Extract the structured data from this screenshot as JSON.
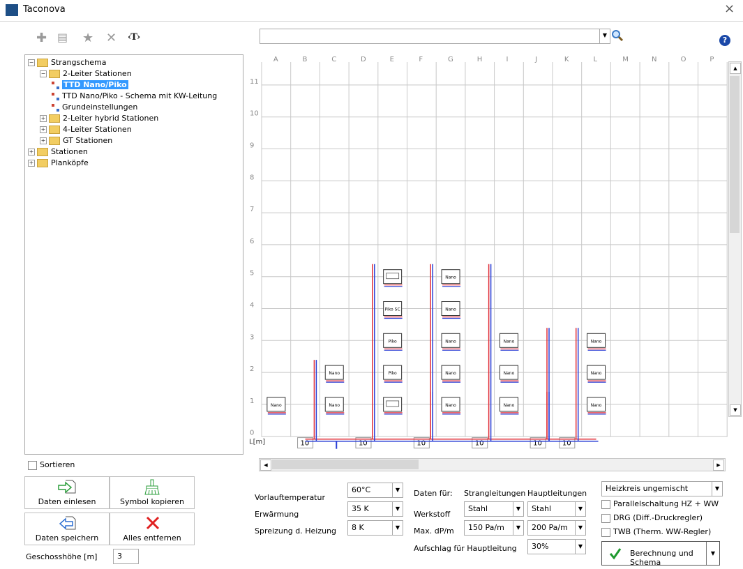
{
  "window": {
    "title": "Taconova",
    "close": "×"
  },
  "toolbar": {
    "add": "✚",
    "edit": "▤",
    "star": "★",
    "delete": "✕",
    "text": "‹T›",
    "help": "?"
  },
  "search": {
    "value": "",
    "icon": "search-icon"
  },
  "tree": [
    {
      "label": "Strangschema",
      "level": 0,
      "type": "folder",
      "expander": "−"
    },
    {
      "label": "2-Leiter Stationen",
      "level": 1,
      "type": "folder",
      "expander": "−"
    },
    {
      "label": "TTD Nano/Piko",
      "level": 2,
      "type": "leaf",
      "selected": true
    },
    {
      "label": "TTD Nano/Piko - Schema mit KW-Leitung",
      "level": 2,
      "type": "leaf"
    },
    {
      "label": "Grundeinstellungen",
      "level": 2,
      "type": "leaf"
    },
    {
      "label": "2-Leiter hybrid Stationen",
      "level": 1,
      "type": "folder",
      "expander": "+"
    },
    {
      "label": "4-Leiter Stationen",
      "level": 1,
      "type": "folder",
      "expander": "+"
    },
    {
      "label": "GT Stationen",
      "level": 1,
      "type": "folder",
      "expander": "+"
    },
    {
      "label": "Stationen",
      "level": 0,
      "type": "folder",
      "expander": "+"
    },
    {
      "label": "Planköpfe",
      "level": 0,
      "type": "folder",
      "expander": "+"
    }
  ],
  "sortieren": {
    "label": "Sortieren",
    "checked": false
  },
  "buttons": {
    "einlesen": "Daten einlesen",
    "kopieren": "Symbol kopieren",
    "speichern": "Daten speichern",
    "entfernen": "Alles entfernen"
  },
  "geschoss": {
    "label": "Geschosshöhe [m]",
    "value": "3"
  },
  "grid": {
    "cols": [
      "A",
      "B",
      "C",
      "D",
      "E",
      "F",
      "G",
      "H",
      "I",
      "J",
      "K",
      "L",
      "M",
      "N",
      "O",
      "P"
    ],
    "rows": [
      "11",
      "10",
      "9",
      "8",
      "7",
      "6",
      "5",
      "4",
      "3",
      "2",
      "1",
      "0"
    ],
    "lm_label": "L[m]",
    "lengths": [
      "",
      "10",
      "",
      "10",
      "",
      "10",
      "",
      "10",
      "",
      "10",
      "10",
      "",
      "",
      "",
      "",
      ""
    ],
    "dots": "...",
    "stations": [
      {
        "col": 5,
        "row": 5,
        "label": ""
      },
      {
        "col": 7,
        "row": 5,
        "label": "Nano"
      },
      {
        "col": 5,
        "row": 4,
        "label": "Piko SC"
      },
      {
        "col": 7,
        "row": 4,
        "label": "Nano"
      },
      {
        "col": 5,
        "row": 3,
        "label": "Piko"
      },
      {
        "col": 7,
        "row": 3,
        "label": "Nano"
      },
      {
        "col": 9,
        "row": 3,
        "label": "Nano"
      },
      {
        "col": 12,
        "row": 3,
        "label": "Nano"
      },
      {
        "col": 3,
        "row": 2,
        "label": "Nano"
      },
      {
        "col": 5,
        "row": 2,
        "label": "Piko"
      },
      {
        "col": 7,
        "row": 2,
        "label": "Nano"
      },
      {
        "col": 9,
        "row": 2,
        "label": "Nano"
      },
      {
        "col": 12,
        "row": 2,
        "label": "Nano"
      },
      {
        "col": 1,
        "row": 1,
        "label": "Nano"
      },
      {
        "col": 3,
        "row": 1,
        "label": "Nano"
      },
      {
        "col": 5,
        "row": 1,
        "label": ""
      },
      {
        "col": 7,
        "row": 1,
        "label": "Nano"
      },
      {
        "col": 9,
        "row": 1,
        "label": "Nano"
      },
      {
        "col": 12,
        "row": 1,
        "label": "Nano"
      }
    ],
    "risers": [
      {
        "col": 2,
        "from": 0,
        "to": 2
      },
      {
        "col": 4,
        "from": 0,
        "to": 5
      },
      {
        "col": 6,
        "from": 0,
        "to": 5
      },
      {
        "col": 6,
        "from": 0,
        "to": 1
      },
      {
        "col": 8,
        "from": 0,
        "to": 5
      },
      {
        "col": 10,
        "from": 0,
        "to": 3
      },
      {
        "col": 11,
        "from": 0,
        "to": 3
      },
      {
        "col": 10,
        "from": 0,
        "to": 1
      }
    ]
  },
  "form": {
    "vorlauf": {
      "label": "Vorlauftemperatur",
      "value": "60°C"
    },
    "erwaermung": {
      "label": "Erwärmung",
      "value": "35 K"
    },
    "spreizung": {
      "label": "Spreizung d. Heizung",
      "value": "8 K"
    },
    "daten_fuer": "Daten für:",
    "strang": "Strangleitungen",
    "haupt": "Hauptleitungen",
    "werkstoff": {
      "label": "Werkstoff",
      "strang": "Stahl",
      "haupt": "Stahl"
    },
    "maxdp": {
      "label": "Max. dP/m",
      "strang": "150 Pa/m",
      "haupt": "200 Pa/m"
    },
    "aufschlag": {
      "label": "Aufschlag für Hauptleitung",
      "value": "30%"
    }
  },
  "options": {
    "heizkreis": "Heizkreis ungemischt",
    "parallel": "Parallelschaltung HZ + WW",
    "drg": "DRG (Diff.-Druckregler)",
    "twb": "TWB (Therm. WW-Regler)"
  },
  "calc_button": "Berechnung und Schema",
  "colors": {
    "selection": "#3399ff",
    "pipe_red": "#e0303a",
    "pipe_blue": "#2b3fd6",
    "check": "#1f9a2f"
  }
}
